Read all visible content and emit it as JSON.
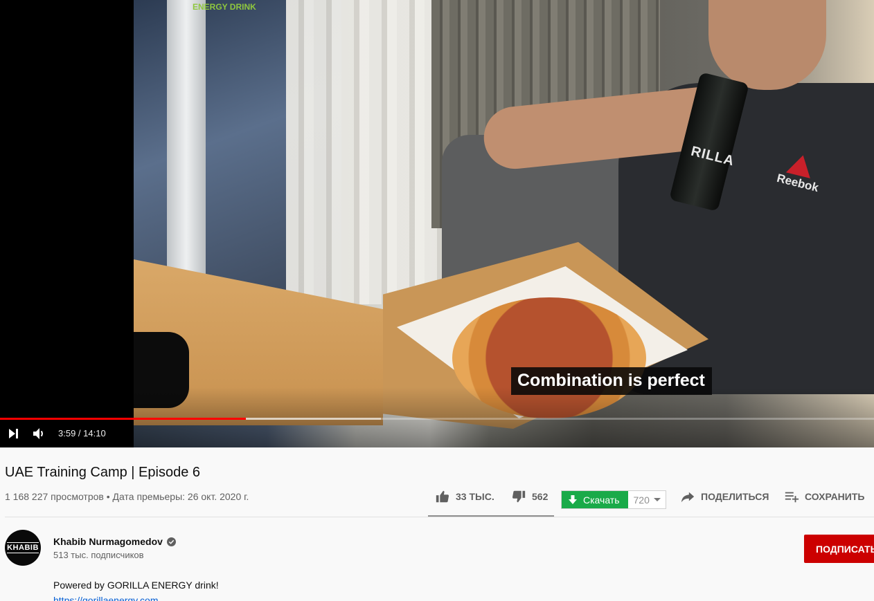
{
  "player": {
    "caption": "Combination is perfect",
    "watermark": "ENERGY DRINK",
    "current_time": "3:59",
    "duration": "14:10",
    "progress_fraction": 0.281,
    "icons": {
      "next": "next-icon",
      "volume": "volume-icon"
    },
    "scene_text": {
      "can_label": "RILLA",
      "shirt_logo": "Reebok"
    }
  },
  "video": {
    "title": "UAE Training Camp | Episode 6",
    "views": "1 168 227 просмотров",
    "premiere": "Дата премьеры: 26 окт. 2020 г."
  },
  "actions": {
    "likes": "33 ТЫС.",
    "dislikes": "562",
    "download_label": "Скачать",
    "download_quality": "720",
    "share_label": "ПОДЕЛИТЬСЯ",
    "save_label": "СОХРАНИТЬ"
  },
  "channel": {
    "avatar_text": "KHABIB",
    "name": "Khabib Nurmagomedov",
    "subscribers": "513 тыс. подписчиков",
    "subscribe_label": "ПОДПИСАТЬСЯ"
  },
  "description": {
    "text": "Powered by GORILLA ENERGY drink!",
    "link": "https://gorillaenergy.com"
  },
  "colors": {
    "progress": "#ff0000",
    "download": "#1aaa49",
    "subscribe": "#cc0000",
    "link": "#065fd4"
  }
}
